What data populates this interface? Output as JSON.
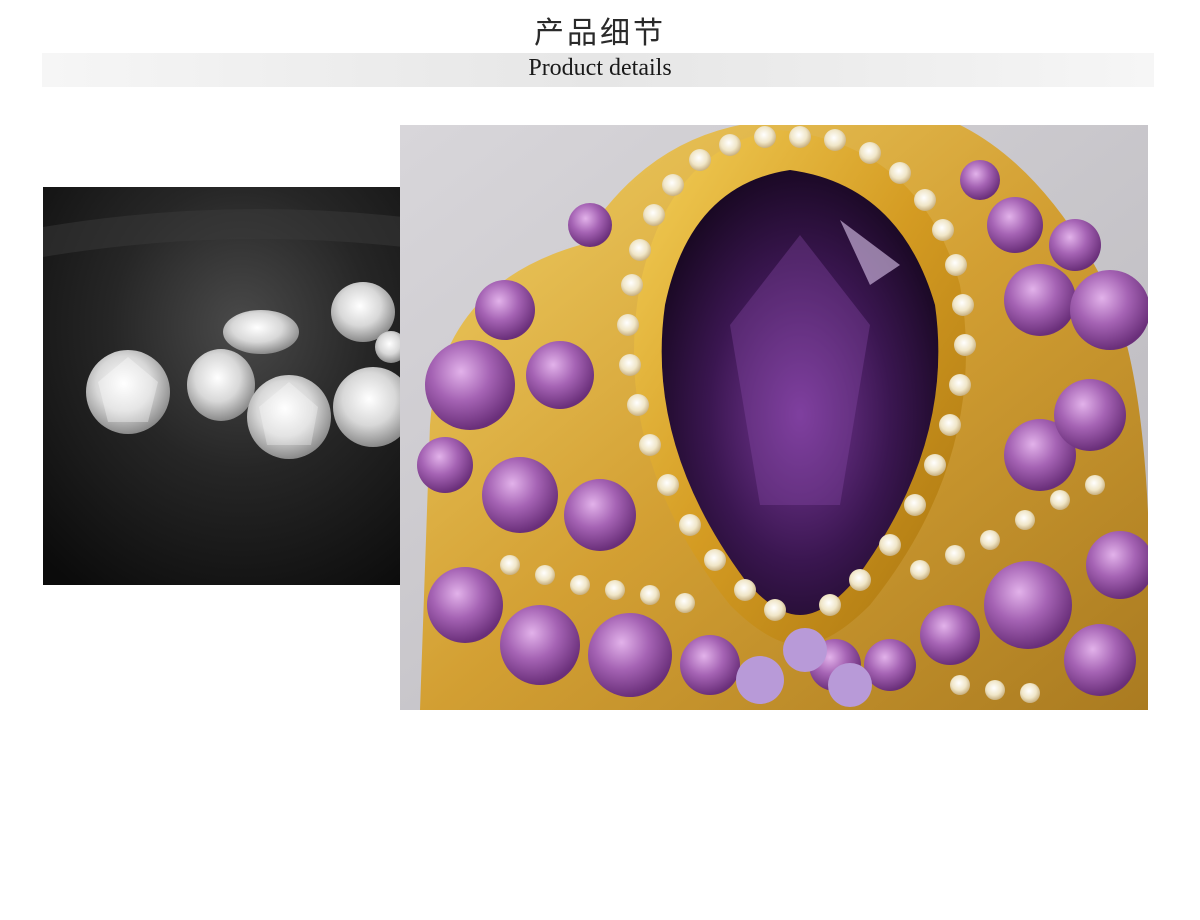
{
  "header": {
    "title_cn": "产品细节",
    "title_en": "Product details"
  },
  "images": {
    "left": {
      "subject": "loose clear crystal gemstones on dark leather",
      "bg": "#1c1c1c"
    },
    "right": {
      "subject": "gold brooch with purple teardrop stone and amethyst crystals",
      "bg": "#c9c7cc"
    }
  },
  "colors": {
    "gold": "#d9a22a",
    "amethyst": "#a25fb0",
    "deep_purple": "#2a0f3a"
  }
}
